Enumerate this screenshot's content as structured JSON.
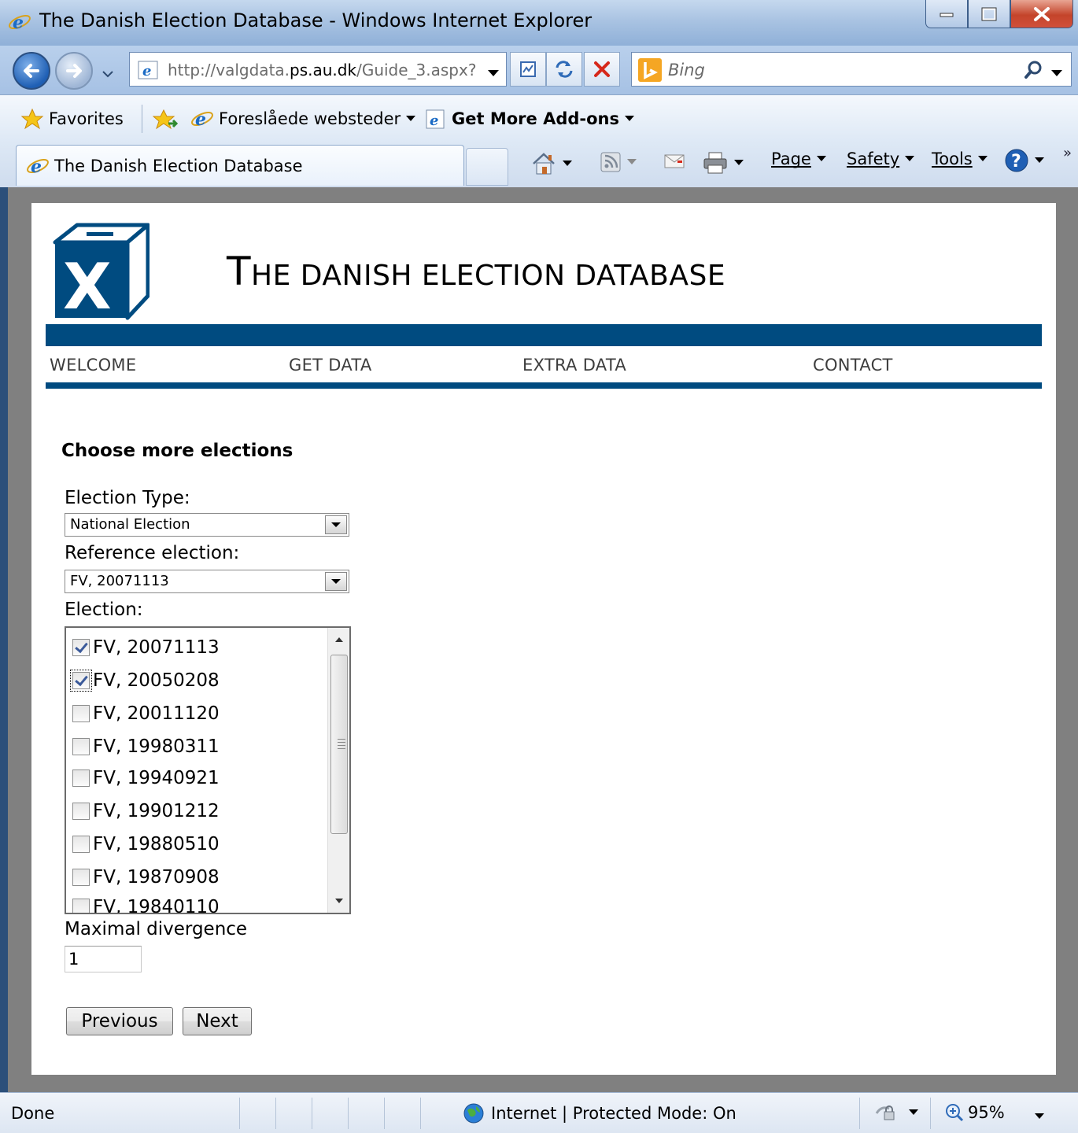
{
  "window": {
    "title": "The Danish Election Database - Windows Internet Explorer"
  },
  "nav": {
    "url_prefix": "http://valgdata.",
    "url_domain": "ps.au.dk",
    "url_suffix": "/Guide_3.aspx?",
    "search_placeholder": "Bing"
  },
  "favorites": {
    "favorites_label": "Favorites",
    "suggested_label": "Foreslåede websteder",
    "addons_label": "Get More Add-ons"
  },
  "tab": {
    "title": "The Danish Election Database"
  },
  "commands": {
    "page": "Page",
    "safety": "Safety",
    "tools": "Tools"
  },
  "site": {
    "logo_letter": "X",
    "title_first": "T",
    "title_rest": "HE DANISH ELECTION DATABASE",
    "menu": [
      "WELCOME",
      "GET DATA",
      "EXTRA DATA",
      "CONTACT"
    ]
  },
  "form": {
    "heading": "Choose more elections",
    "election_type_label": "Election Type:",
    "election_type_value": "National Election",
    "reference_label": "Reference election:",
    "reference_value": "FV, 20071113",
    "election_label": "Election:",
    "elections": [
      {
        "label": "FV, 20071113",
        "checked": true
      },
      {
        "label": "FV, 20050208",
        "checked": true
      },
      {
        "label": "FV, 20011120",
        "checked": false
      },
      {
        "label": "FV, 19980311",
        "checked": false
      },
      {
        "label": "FV, 19940921",
        "checked": false
      },
      {
        "label": "FV, 19901212",
        "checked": false
      },
      {
        "label": "FV, 19880510",
        "checked": false
      },
      {
        "label": "FV, 19870908",
        "checked": false
      },
      {
        "label": "FV, 19840110",
        "checked": false
      }
    ],
    "divergence_label": "Maximal divergence",
    "divergence_value": "1",
    "previous_label": "Previous",
    "next_label": "Next"
  },
  "status": {
    "text": "Done",
    "zone": "Internet | Protected Mode: On",
    "zoom": "95%"
  },
  "colors": {
    "brand_blue": "#004b80",
    "viewport_gray": "#808080"
  }
}
